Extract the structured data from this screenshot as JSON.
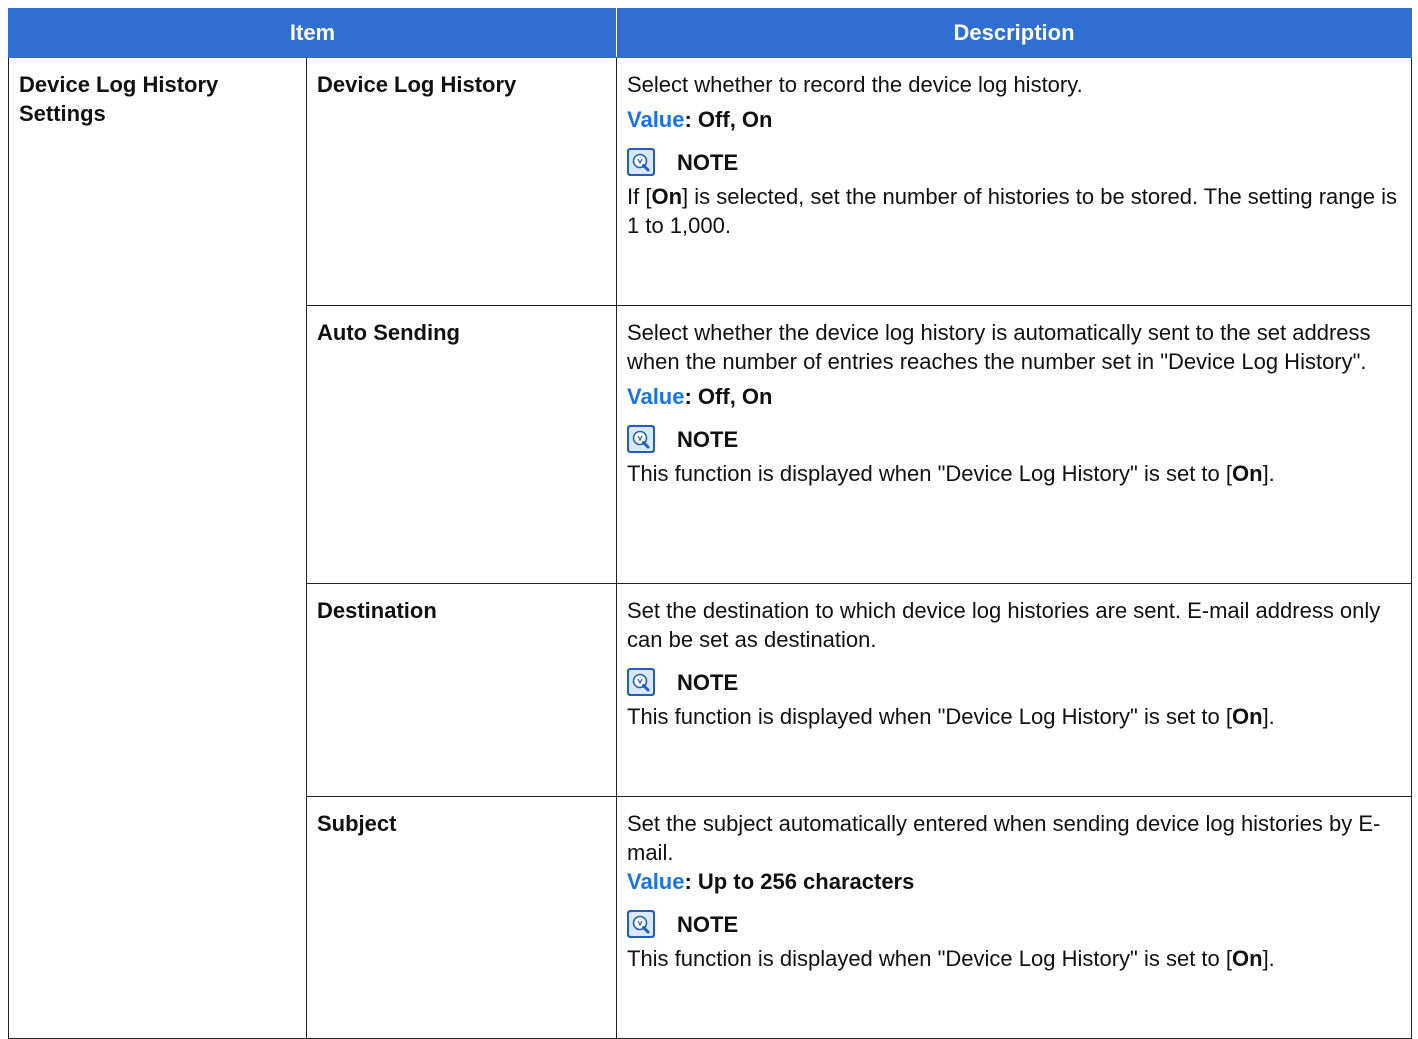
{
  "header": {
    "item_label": "Item",
    "description_label": "Description"
  },
  "group_label": "Device Log History Settings",
  "rows": [
    {
      "name": "Device Log History",
      "description": "Select whether to record the device log history.",
      "value_label": "Value",
      "value_text": ": Off, On",
      "note_title": "NOTE",
      "note_prefix": "If [",
      "note_bold": "On",
      "note_suffix": "] is selected, set the number of histories to be stored. The setting range is 1 to 1,000."
    },
    {
      "name": "Auto Sending",
      "description": "Select whether the device log history is automatically sent to the set address when the number of entries reaches the number set in \"Device Log History\".",
      "value_label": "Value",
      "value_text": ": Off, On",
      "note_title": "NOTE",
      "note_prefix": "This function is displayed when \"Device Log History\" is set to [",
      "note_bold": "On",
      "note_suffix": "]."
    },
    {
      "name": "Destination",
      "description": "Set the destination to which device log histories are sent. E-mail address only can be set as destination.",
      "note_title": "NOTE",
      "note_prefix": "This function is displayed when \"Device Log History\" is set to [",
      "note_bold": "On",
      "note_suffix": "]."
    },
    {
      "name": "Subject",
      "description": "Set the subject automatically entered when sending device log histories by E-mail.",
      "value_label": "Value",
      "value_text": ": Up to 256 characters",
      "note_title": "NOTE",
      "note_prefix": "This function is displayed when \"Device Log History\" is set to [",
      "note_bold": "On",
      "note_suffix": "]."
    }
  ],
  "icons": {
    "note": "lightbulb-note-icon"
  },
  "colors": {
    "header_bg": "#2e6fd1",
    "value_label": "#1a73e8",
    "icon_blue": "#1f5fbf"
  }
}
